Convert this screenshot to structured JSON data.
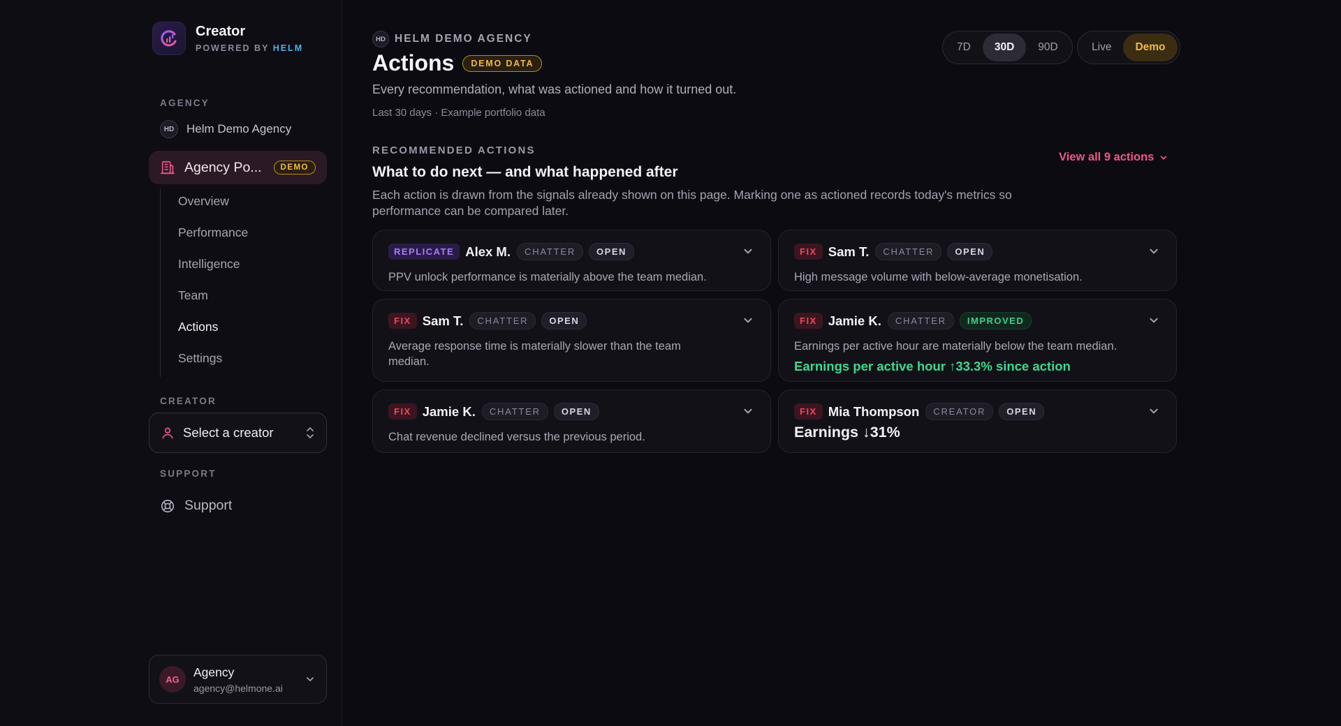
{
  "brand": {
    "name": "Creator",
    "powered_by": "POWERED BY",
    "helm": "HELM"
  },
  "sidebar": {
    "agency_label": "AGENCY",
    "agency_initials": "HD",
    "agency_name": "Helm Demo Agency",
    "portal_label": "Agency Po...",
    "portal_badge": "DEMO",
    "nav": [
      {
        "label": "Overview"
      },
      {
        "label": "Performance"
      },
      {
        "label": "Intelligence"
      },
      {
        "label": "Team"
      },
      {
        "label": "Actions",
        "active": true
      },
      {
        "label": "Settings"
      }
    ],
    "creator_label": "CREATOR",
    "creator_select": "Select a creator",
    "support_label": "SUPPORT",
    "support_item": "Support",
    "account": {
      "initials": "AG",
      "name": "Agency",
      "email": "agency@helmone.ai"
    }
  },
  "header": {
    "crumb_initials": "HD",
    "crumb": "HELM DEMO AGENCY",
    "title": "Actions",
    "badge": "DEMO DATA",
    "subtitle": "Every recommendation, what was actioned and how it turned out.",
    "period_note": "Last 30 days · Example portfolio data",
    "ranges": [
      "7D",
      "30D",
      "90D"
    ],
    "selected_range": "30D",
    "modes": [
      "Live",
      "Demo"
    ],
    "selected_mode": "Demo"
  },
  "recommended": {
    "label": "RECOMMENDED ACTIONS",
    "heading": "What to do next — and what happened after",
    "description": "Each action is drawn from the signals already shown on this page. Marking one as actioned records today's metrics so performance can be compared later.",
    "view_all": "View all 9 actions"
  },
  "cards": [
    {
      "tag": "REPLICATE",
      "person": "Alex M.",
      "role": "CHATTER",
      "status": "OPEN",
      "body": "PPV unlock performance is materially above the team median."
    },
    {
      "tag": "FIX",
      "person": "Sam T.",
      "role": "CHATTER",
      "status": "OPEN",
      "body": "High message volume with below-average monetisation."
    },
    {
      "tag": "FIX",
      "person": "Sam T.",
      "role": "CHATTER",
      "status": "OPEN",
      "body": "Average response time is materially slower than the team median."
    },
    {
      "tag": "FIX",
      "person": "Jamie K.",
      "role": "CHATTER",
      "status": "IMPROVED",
      "body": "Earnings per active hour are materially below the team median.",
      "result": "Earnings per active hour ↑33.3% since action"
    },
    {
      "tag": "FIX",
      "person": "Jamie K.",
      "role": "CHATTER",
      "status": "OPEN",
      "body": "Chat revenue declined versus the previous period."
    },
    {
      "tag": "FIX",
      "person": "Mia Thompson",
      "role": "CREATOR",
      "status": "OPEN",
      "result": "Earnings ↓31%"
    }
  ],
  "colors": {
    "accent": "#f0568a",
    "demo": "#f2b94a",
    "improved": "#3ecf8e",
    "fix": "#f0475e",
    "replicate": "#a77df5"
  }
}
